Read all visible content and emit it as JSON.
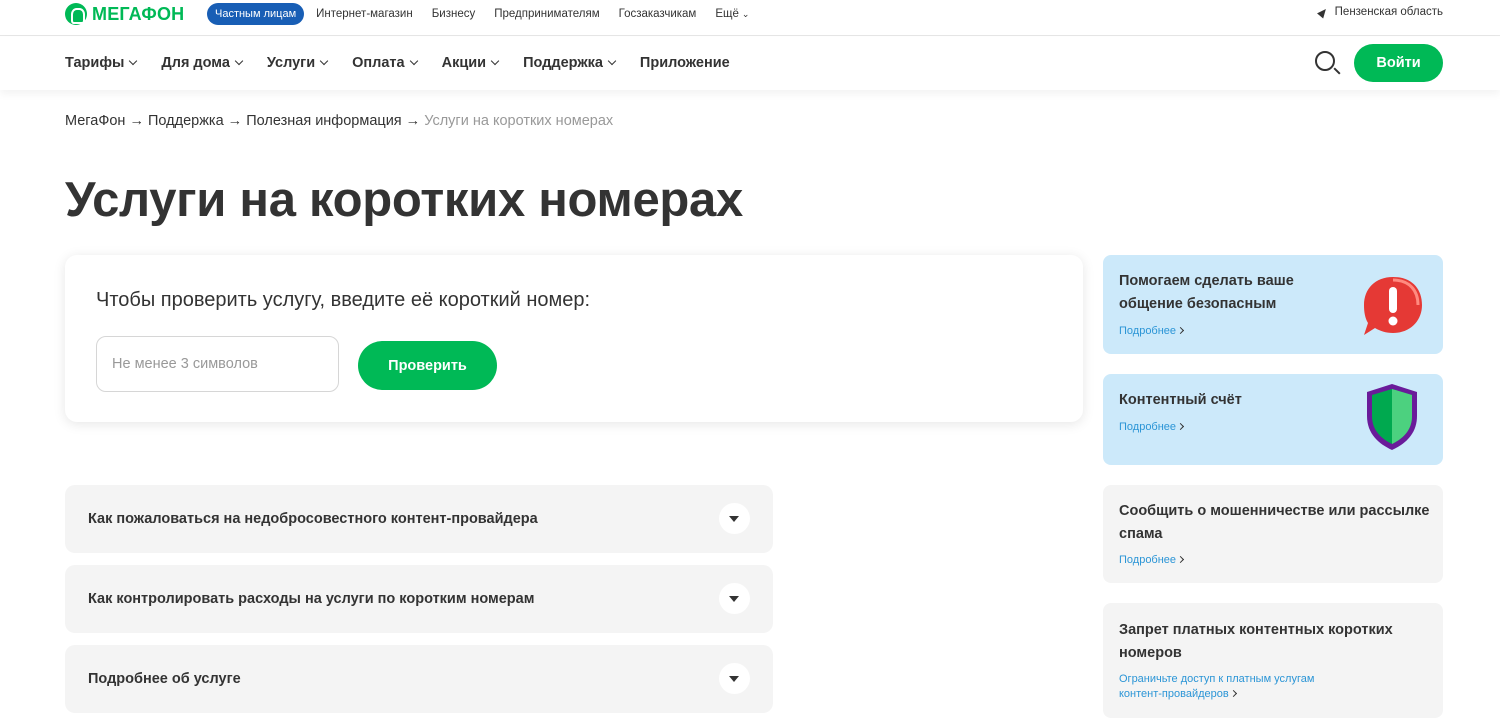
{
  "brand": {
    "name": "МЕГАФОН",
    "accent": "#00b956",
    "blue": "#185eb5"
  },
  "topbar": {
    "segments": [
      {
        "label": "Частным лицам",
        "active": true
      },
      {
        "label": "Интернет-магазин"
      },
      {
        "label": "Бизнесу"
      },
      {
        "label": "Предпринимателям"
      },
      {
        "label": "Госзаказчикам"
      },
      {
        "label": "Ещё"
      }
    ],
    "region": "Пензенская область"
  },
  "nav": {
    "items": [
      "Тарифы",
      "Для дома",
      "Услуги",
      "Оплата",
      "Акции",
      "Поддержка",
      "Приложение"
    ],
    "login": "Войти"
  },
  "breadcrumb": {
    "items": [
      "МегаФон",
      "Поддержка",
      "Полезная информация"
    ],
    "current": "Услуги на коротких номерах",
    "separator": " → "
  },
  "page_title": "Услуги на коротких номерах",
  "check": {
    "title": "Чтобы проверить услугу, введите её короткий номер:",
    "placeholder": "Не менее 3 символов",
    "value": "",
    "button": "Проверить"
  },
  "accordion": [
    "Как пожаловаться на недобросовестного контент-провайдера",
    "Как контролировать расходы на услуги по коротким номерам",
    "Подробнее об услуге"
  ],
  "sidebar": [
    {
      "title": "Помогаем сделать ваше общение безопасным",
      "link": "Подробнее",
      "icon": "alert-bubble-icon"
    },
    {
      "title": "Контентный счёт",
      "link": "Подробнее",
      "icon": "shield-icon"
    },
    {
      "title": "Сообщить о мошенничестве или рассылке спама",
      "link": "Подробнее"
    },
    {
      "title": "Запрет платных контентных коротких номеров",
      "link": "Ограничьте доступ к платным услугам контент-провайдеров"
    }
  ]
}
